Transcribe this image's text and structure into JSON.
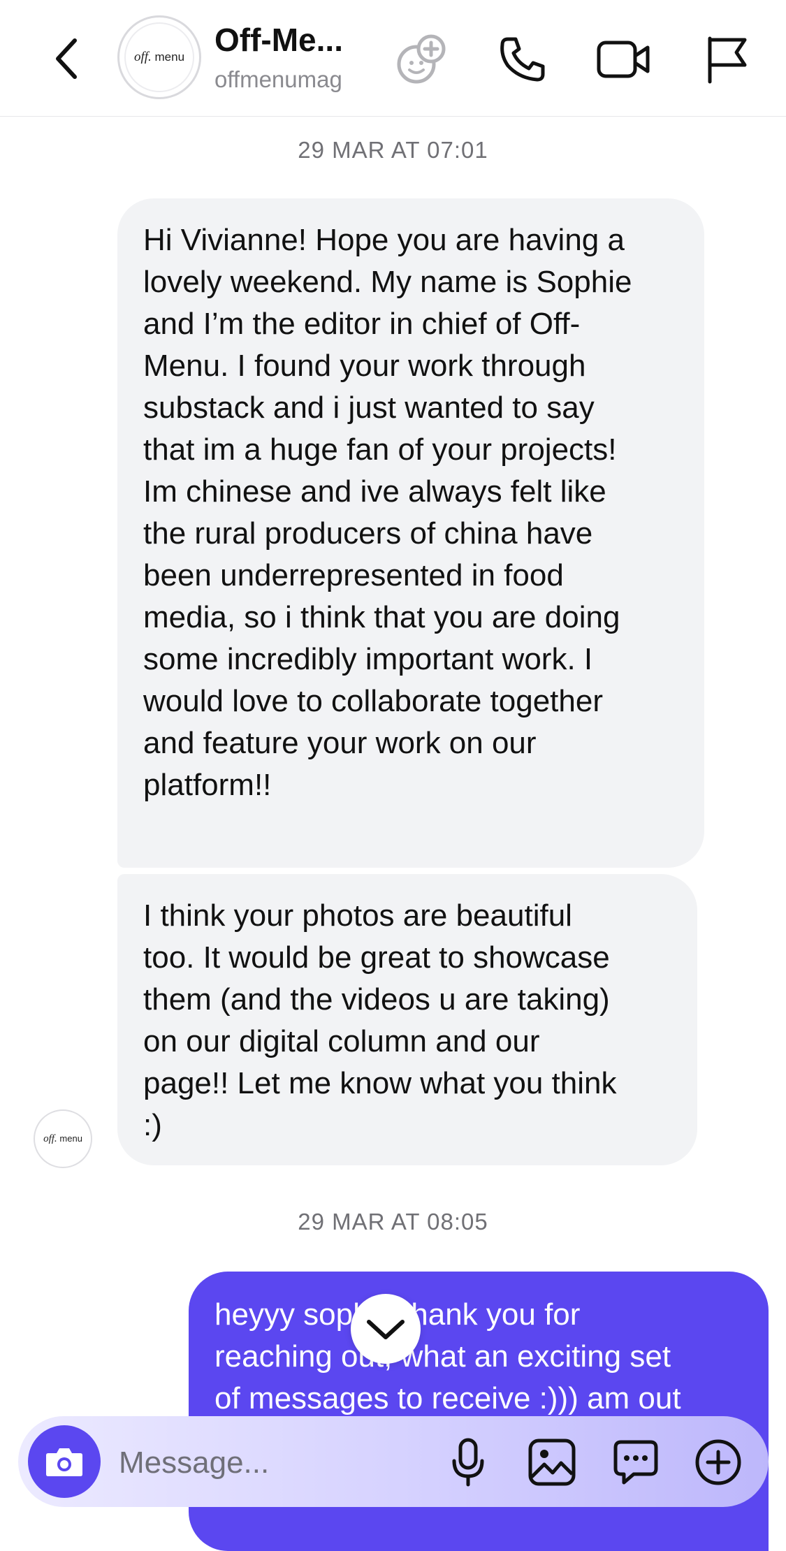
{
  "header": {
    "title": "Off-Me...",
    "username": "offmenumag",
    "avatar_logo": {
      "italic": "off.",
      "plain": "menu"
    }
  },
  "thread": {
    "timestamp_1": "29 MAR AT 07:01",
    "received": [
      {
        "lines": [
          "Hi Vivianne! Hope you are having a",
          "lovely weekend. My name is Sophie",
          "and I’m the editor in chief of Off-",
          "Menu. I found your work through",
          "substack and i just wanted to say",
          "that im a huge fan of your projects!",
          "Im chinese and ive always felt like",
          "the rural producers of china have",
          "been underrepresented in food",
          "media, so i think that you are doing",
          "some incredibly important work. I",
          "would love to collaborate together",
          "and feature your work on our",
          "platform!!"
        ]
      },
      {
        "lines": [
          "I think your photos are beautiful",
          "too. It would be great to showcase",
          "them (and the videos u are taking)",
          "on our digital column and our",
          "page!! Let me know what you think",
          ":)"
        ]
      }
    ],
    "timestamp_2": "29 MAR AT 08:05",
    "sent": {
      "lines": [
        "heyyy sophie thank you for",
        "reaching out, what an exciting set",
        "of messages to receive :))) am out"
      ]
    }
  },
  "composer": {
    "placeholder": "Message..."
  },
  "colors": {
    "accent": "#5b47f0",
    "received_bubble": "#f2f3f5",
    "timestamp": "#707075"
  },
  "icons": [
    "back-chevron-icon",
    "add-avatar-icon",
    "phone-icon",
    "video-camera-icon",
    "flag-icon",
    "camera-icon",
    "microphone-icon",
    "gallery-icon",
    "sticker-icon",
    "plus-circle-icon",
    "chevron-down-icon"
  ]
}
